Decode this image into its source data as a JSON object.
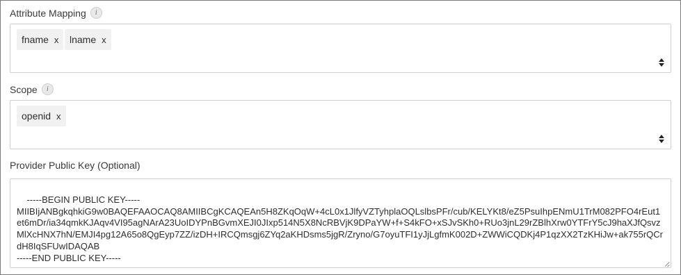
{
  "attribute_mapping": {
    "label": "Attribute Mapping",
    "info_icon": "info-icon",
    "chips": [
      {
        "text": "fname",
        "remove": "x"
      },
      {
        "text": "lname",
        "remove": "x"
      }
    ]
  },
  "scope": {
    "label": "Scope",
    "info_icon": "info-icon",
    "chips": [
      {
        "text": "openid",
        "remove": "x"
      }
    ]
  },
  "public_key": {
    "label": "Provider Public Key (Optional)",
    "value": "-----BEGIN PUBLIC KEY-----\nMIIBIjANBgkqhkiG9w0BAQEFAAOCAQ8AMIIBCgKCAQEAn5H8ZKqOqW+4cL0x1JlfyVZTyhplaOQLslbsPFr/cub/KELYKt8/eZ5PsuIhpENmU1TrM082PFO4rEut1et6mDr/ia34qmkKJAqv4VI95agNArA23UoIDYPnBGvmXEJI0JIxp514N5X8NcRBVjK9DPaYW+f+S4kFO+xSJvSKh0+RUo3jnL29rZBlhXrw0YTFrY5cJ9haXJfQsvzMlXcHNX7hN/EMJI4pg12A65o8QgEyp7ZZ/izDH+IRCQmsgj6ZYq2aKHDsms5jgR/Zryno/G7oyuTFI1yJjLgfmK002D+ZWWiCQDKj4P1qzXX2TzKHiJw+ak755rQCrdH8IqSFUwIDAQAB\n-----END PUBLIC KEY-----"
  }
}
